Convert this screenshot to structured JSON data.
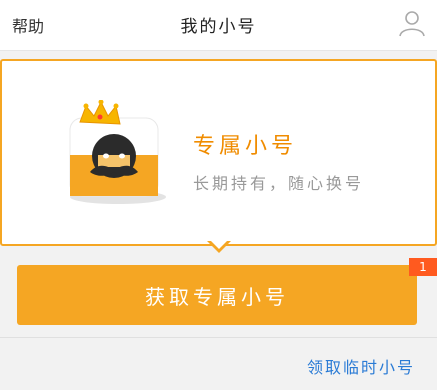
{
  "navbar": {
    "help_label": "帮助",
    "title": "我的小号",
    "user_icon": "user-icon"
  },
  "card": {
    "title": "专属小号",
    "subtitle": "长期持有，随心换号",
    "mascot_icon": "crowned-mascot-icon"
  },
  "actions": {
    "primary_label": "获取专属小号",
    "badge": "1",
    "temp_link": "领取临时小号"
  },
  "colors": {
    "accent": "#f5a623",
    "title_orange": "#f08c00",
    "link_blue": "#2a7bd5",
    "badge_red": "#ff5a1f"
  }
}
